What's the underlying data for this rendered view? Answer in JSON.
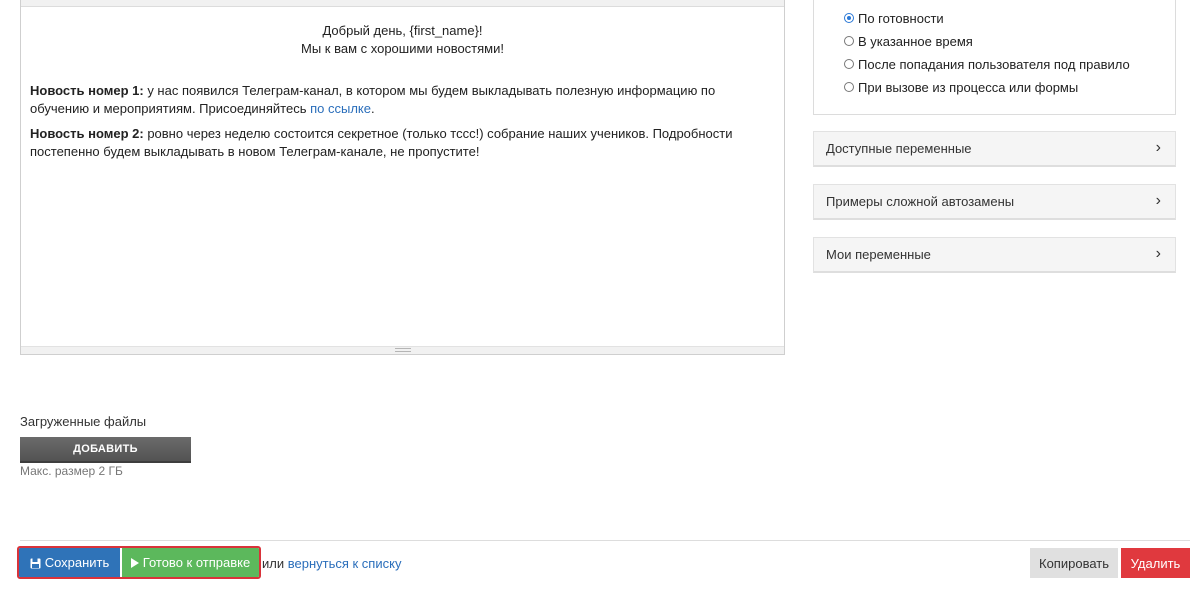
{
  "editor": {
    "greeting": "Добрый день, {first_name}!",
    "subgreeting": "Мы к вам с хорошими новостями!",
    "news1_label": "Новость номер 1:",
    "news1_text": " у нас появился Телеграм-канал, в котором мы будем выкладывать полезную информацию по обучению и мероприятиям. Присоединяйтесь ",
    "news1_link": "по ссылке",
    "news1_end": ".",
    "news2_label": "Новость номер 2:",
    "news2_text": " ровно через неделю состоится секретное (только тссс!) собрание наших учеников. Подробности постепенно будем выкладывать в новом Телеграм-канале, не пропустите!"
  },
  "send_options": [
    {
      "label": "По готовности",
      "checked": true
    },
    {
      "label": "В указанное время",
      "checked": false
    },
    {
      "label": "После попадания пользователя под правило",
      "checked": false
    },
    {
      "label": "При вызове из процесса или формы",
      "checked": false
    }
  ],
  "accordions": [
    {
      "label": "Доступные переменные"
    },
    {
      "label": "Примеры сложной автозамены"
    },
    {
      "label": "Мои переменные"
    }
  ],
  "files": {
    "label": "Загруженные файлы",
    "add_button": "ДОБАВИТЬ",
    "max_size": "Макс. размер 2 ГБ"
  },
  "toolbar": {
    "save": "Сохранить",
    "ready": "Готово к отправке",
    "or": "или ",
    "back_link": "вернуться к списку",
    "copy": "Копировать",
    "delete": "Удалить"
  },
  "colors": {
    "save": "#2f73b8",
    "ready": "#5cb85c",
    "delete": "#e0393e",
    "highlight": "#d9333a",
    "link": "#2a6ebb"
  }
}
